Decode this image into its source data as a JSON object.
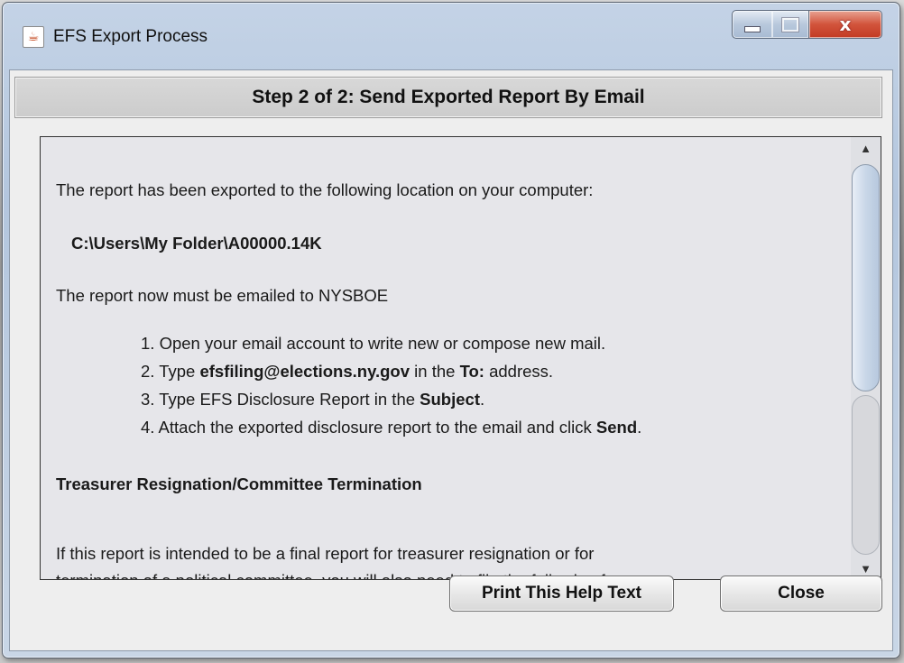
{
  "window": {
    "title": "EFS Export Process",
    "app_icon_glyph": "☕",
    "controls": {
      "minimize": "minimize-icon",
      "maximize": "maximize-icon",
      "close": "close-icon",
      "close_glyph": "x"
    },
    "colors": {
      "close_button": "#c33a23",
      "titlebar": "#b9cbe0"
    }
  },
  "header": {
    "title": "Step 2 of 2: Send Exported Report By Email"
  },
  "help": {
    "intro": "The report has been exported to the following location on your computer:",
    "path": "C:\\Users\\My Folder\\A00000.14K",
    "must_email": "The report now must be emailed to NYSBOE",
    "steps": [
      {
        "prefix": "1.  Open your email account to write new or compose new mail."
      },
      {
        "prefix": "2.  Type ",
        "bold1": "efsfiling@elections.ny.gov",
        "mid": " in the ",
        "bold2": "To:",
        "suffix": " address."
      },
      {
        "prefix": "3.  Type EFS Disclosure Report in the ",
        "bold1": "Subject",
        "suffix": "."
      },
      {
        "prefix": "4.  Attach the exported disclosure report to the email and click ",
        "bold1": "Send",
        "suffix": "."
      }
    ],
    "section_heading": "Treasurer Resignation/Committee Termination",
    "final_text": "If this report is intended to be a final report for treasurer resignation or for",
    "cut_line": "termination of a political committee, you will also need to file the following forms"
  },
  "scrollbar": {
    "up_glyph": "▲",
    "down_glyph": "▼"
  },
  "buttons": {
    "print": "Print This Help Text",
    "close": "Close"
  }
}
